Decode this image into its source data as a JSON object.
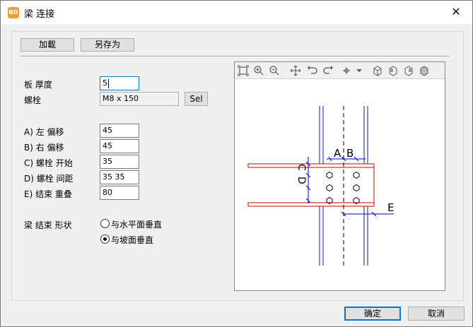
{
  "window": {
    "title": "梁 连接",
    "app_icon": "BD",
    "close_glyph": "✕"
  },
  "top_buttons": {
    "load": "加載",
    "save_as": "另存为"
  },
  "form": {
    "plate_thickness": {
      "label": "板 厚度",
      "value": "5"
    },
    "bolt": {
      "label": "螺栓",
      "value": "M8 x 150",
      "sel_button": "Sel"
    },
    "left_offset": {
      "label": "A) 左 偏移",
      "value": "45"
    },
    "right_offset": {
      "label": "B) 右 偏移",
      "value": "45"
    },
    "bolt_start": {
      "label": "C) 螺栓 开始",
      "value": "35"
    },
    "bolt_spacing": {
      "label": "D) 螺栓 间距",
      "value": "35 35"
    },
    "end_overlap": {
      "label": "E) 结束 重叠",
      "value": "80"
    },
    "end_shape": {
      "label": "梁 结束 形状",
      "options": [
        "与水平面垂直",
        "与坡面垂直"
      ],
      "selected": "与坡面垂直"
    }
  },
  "preview": {
    "toolbar_icons": [
      "zoom-extents-icon",
      "zoom-in-icon",
      "zoom-out-icon",
      "pan-icon",
      "undo-view-icon",
      "redo-view-icon",
      "snap-icon",
      "dropdown-icon",
      "view1-icon",
      "view2-icon",
      "view3-icon",
      "view4-icon"
    ],
    "dim_labels": {
      "a": "A",
      "b": "B",
      "c": "C",
      "d": "D",
      "e": "E"
    },
    "colors": {
      "beam": "#cc0000",
      "column": "#1a1aa0",
      "dimension": "#0000cc",
      "centerline": "#000000"
    }
  },
  "footer": {
    "ok": "确定",
    "cancel": "取消"
  }
}
